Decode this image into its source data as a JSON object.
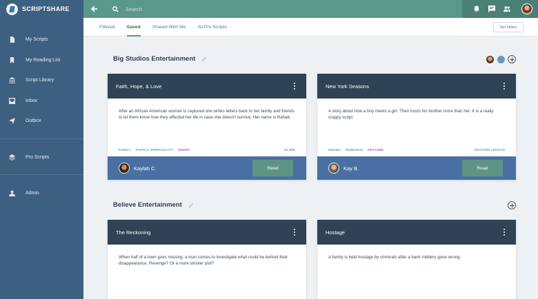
{
  "app": {
    "brand": "SCRIPTSHARE"
  },
  "sidebar": {
    "items": [
      {
        "label": "My Scripts",
        "icon": "file-icon"
      },
      {
        "label": "My Reading List",
        "icon": "bookmark-icon"
      },
      {
        "label": "Script Library",
        "icon": "library-icon"
      },
      {
        "label": "Inbox",
        "icon": "inbox-icon"
      },
      {
        "label": "Outbox",
        "icon": "send-icon"
      }
    ],
    "pro": {
      "label": "Pro Scripts",
      "icon": "layers-icon"
    },
    "admin": {
      "label": "Admin",
      "icon": "person-icon"
    }
  },
  "topbar": {
    "search_placeholder": "Search",
    "icons": [
      "back-arrow-icon",
      "search-icon",
      "bell-icon",
      "chat-icon",
      "people-icon"
    ]
  },
  "tabs": [
    {
      "label": "Filtered",
      "active": false
    },
    {
      "label": "Saved",
      "active": true
    },
    {
      "label": "Shared With Me",
      "active": false
    },
    {
      "label": "All Pro Scripts",
      "active": false
    }
  ],
  "filters_button": "Set Filters",
  "groups": [
    {
      "title": "Big Studios Entertainment",
      "cards": [
        {
          "title": "Faith, Hope, & Love",
          "description": "After an African-American woman is captured she writes letters back to her family and friends to let them know how they affected her life in case she doesn't survive. Her name is Rahab.",
          "tags": [
            {
              "label": "FAMILY",
              "color": "#4aa79a"
            },
            {
              "label": "FAITH & SPIRITUALITY",
              "color": "#4aa79a"
            },
            {
              "label": "SHORT",
              "color": "#b254a8"
            }
          ],
          "length": "30 MIN",
          "author": "Kaylah C.",
          "read_label": "Read"
        },
        {
          "title": "New York Seasons",
          "description": "A story about how a boy meets a girl. Then trusts his brother more than her. It is a really crappy script.",
          "tags": [
            {
              "label": "DRAMA",
              "color": "#4aa79a"
            },
            {
              "label": "ROMANCE",
              "color": "#4aa79a"
            },
            {
              "label": "FEATURE",
              "color": "#b254a8"
            }
          ],
          "length": "FEATURE LENGTH",
          "author": "Kay B.",
          "read_label": "Read"
        }
      ]
    },
    {
      "title": "Believe Entertainment",
      "cards": [
        {
          "title": "The Reckoning",
          "description": "When half of a town goes missing, a man comes to investigate what could be behind their disappearance. Revenge? Or a more sinister plot?"
        },
        {
          "title": "Hostage",
          "description": "A family is held hostage by criminals after a bank robbery gone wrong."
        }
      ]
    }
  ]
}
